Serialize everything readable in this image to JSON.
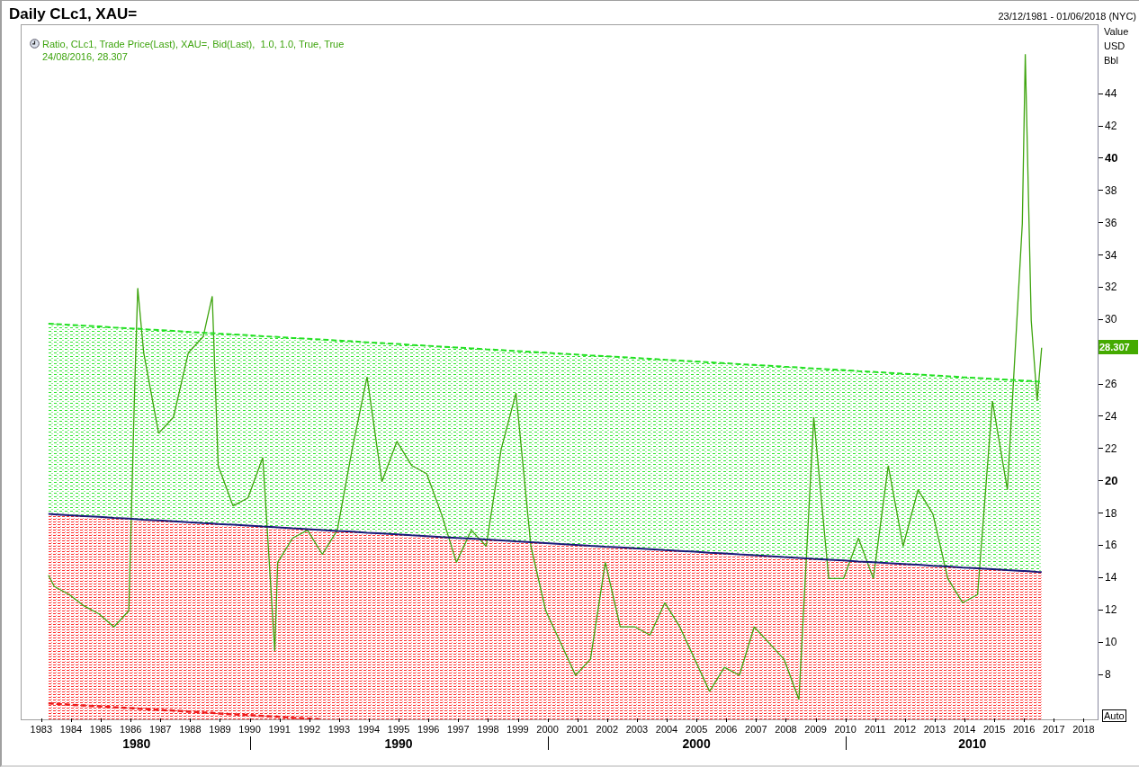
{
  "chart_title": "Daily CLc1, XAU=",
  "date_range": "23/12/1981 - 01/06/2018 (NYC)",
  "legend": {
    "series_text": "Ratio, CLc1, Trade Price(Last), XAU=, Bid(Last),  1.0, 1.0, True, True",
    "last_point": "24/08/2016, 28.307"
  },
  "value_axis": {
    "headings": [
      "Value",
      "USD",
      "Bbl"
    ],
    "last_price": "28.307",
    "auto_button": "Auto"
  },
  "chart_data": {
    "type": "line",
    "xlim": [
      1982.4,
      2018.53
    ],
    "ylim": [
      5.27,
      48.3
    ],
    "xticks": [
      1983,
      1984,
      1985,
      1986,
      1987,
      1988,
      1989,
      1990,
      1991,
      1992,
      1993,
      1994,
      1995,
      1996,
      1997,
      1998,
      1999,
      2000,
      2001,
      2002,
      2003,
      2004,
      2005,
      2006,
      2007,
      2008,
      2009,
      2010,
      2011,
      2012,
      2013,
      2014,
      2015,
      2016,
      2017,
      2018
    ],
    "yticks": [
      8,
      10,
      12,
      14,
      16,
      18,
      20,
      22,
      24,
      26,
      30,
      32,
      34,
      36,
      38,
      40,
      42,
      44
    ],
    "x": [
      1983.3,
      1983.5,
      1984,
      1984.5,
      1985,
      1985.5,
      1986,
      1986.2,
      1986.3,
      1986.5,
      1987,
      1987.5,
      1988,
      1988.5,
      1988.8,
      1989,
      1989.5,
      1990,
      1990.5,
      1990.9,
      1991,
      1991.5,
      1992,
      1992.5,
      1993,
      1993.5,
      1994,
      1994.5,
      1995,
      1995.5,
      1996,
      1996.5,
      1997,
      1997.5,
      1998,
      1998.5,
      1999,
      1999.5,
      2000,
      2000.5,
      2001,
      2001.5,
      2002,
      2002.5,
      2003,
      2003.5,
      2004,
      2004.5,
      2005,
      2005.5,
      2006,
      2006.5,
      2007,
      2007.5,
      2008,
      2008.5,
      2009,
      2009.5,
      2010,
      2010.5,
      2011,
      2011.5,
      2012,
      2012.5,
      2013,
      2013.5,
      2014,
      2014.5,
      2015,
      2015.5,
      2016,
      2016.1,
      2016.3,
      2016.5,
      2016.65
    ],
    "series": [
      {
        "color": "#3ea40e",
        "line_style": "solid",
        "values": [
          14.2,
          13.5,
          13.0,
          12.3,
          11.8,
          11.0,
          12.0,
          26.0,
          32.0,
          28.0,
          23.0,
          24.0,
          28.0,
          29.0,
          31.5,
          21.0,
          18.5,
          19.0,
          21.5,
          9.5,
          15.0,
          16.5,
          17.0,
          15.5,
          17.0,
          22.0,
          26.5,
          20.0,
          22.5,
          21.0,
          20.5,
          18.0,
          15.0,
          17.0,
          16.0,
          22.0,
          25.5,
          16.0,
          12.0,
          10.0,
          8.0,
          9.0,
          15.0,
          11.0,
          11.0,
          10.5,
          12.5,
          11.0,
          9.0,
          7.0,
          8.5,
          8.0,
          11.0,
          10.0,
          9.0,
          6.5,
          24.0,
          14.0,
          14.0,
          16.5,
          14.0,
          21.0,
          16.0,
          19.5,
          18.0,
          14.0,
          12.5,
          13.0,
          25.0,
          19.5,
          36.0,
          46.5,
          30.0,
          25.0,
          28.3
        ]
      },
      {
        "color": "#22e022",
        "line_style": "dashed",
        "values": [
          29.8,
          29.78,
          29.72,
          29.67,
          29.62,
          29.56,
          29.51,
          29.49,
          29.48,
          29.45,
          29.4,
          29.35,
          29.29,
          29.24,
          29.21,
          29.18,
          29.13,
          29.08,
          29.02,
          28.98,
          28.97,
          28.91,
          28.86,
          28.81,
          28.75,
          28.7,
          28.64,
          28.59,
          28.54,
          28.48,
          28.43,
          28.37,
          28.32,
          28.27,
          28.21,
          28.16,
          28.1,
          28.05,
          28.0,
          27.94,
          27.89,
          27.83,
          27.78,
          27.73,
          27.67,
          27.62,
          27.56,
          27.51,
          27.46,
          27.4,
          27.35,
          27.29,
          27.24,
          27.19,
          27.13,
          27.08,
          27.02,
          26.97,
          26.92,
          26.86,
          26.81,
          26.75,
          26.7,
          26.65,
          26.59,
          26.54,
          26.48,
          26.43,
          26.38,
          26.32,
          26.27,
          26.26,
          26.24,
          26.21,
          26.2
        ]
      },
      {
        "color": "#1a1a7a",
        "line_style": "solid",
        "values": [
          18.0,
          17.98,
          17.92,
          17.87,
          17.82,
          17.76,
          17.71,
          17.69,
          17.68,
          17.65,
          17.6,
          17.55,
          17.49,
          17.44,
          17.41,
          17.38,
          17.33,
          17.28,
          17.22,
          17.18,
          17.17,
          17.11,
          17.06,
          17.01,
          16.95,
          16.9,
          16.84,
          16.79,
          16.74,
          16.68,
          16.63,
          16.57,
          16.52,
          16.47,
          16.41,
          16.36,
          16.3,
          16.25,
          16.2,
          16.14,
          16.09,
          16.03,
          15.98,
          15.93,
          15.87,
          15.82,
          15.76,
          15.71,
          15.66,
          15.6,
          15.55,
          15.49,
          15.44,
          15.39,
          15.33,
          15.28,
          15.22,
          15.17,
          15.12,
          15.06,
          15.01,
          14.95,
          14.9,
          14.85,
          14.79,
          14.74,
          14.68,
          14.63,
          14.58,
          14.52,
          14.47,
          14.46,
          14.44,
          14.41,
          14.4
        ]
      },
      {
        "color": "#ee1c1c",
        "line_style": "dashed",
        "values": [
          6.26,
          6.24,
          6.18,
          6.13,
          6.08,
          6.02,
          5.97,
          5.95,
          5.94,
          5.91,
          5.86,
          5.81,
          5.75,
          5.7,
          5.67,
          5.64,
          5.59,
          5.54,
          5.48,
          5.44,
          5.43,
          5.37,
          5.32,
          5.27,
          null,
          null,
          null,
          null,
          null,
          null,
          null,
          null,
          null,
          null,
          null,
          null,
          null,
          null,
          null,
          null,
          null,
          null,
          null,
          null,
          null,
          null,
          null,
          null,
          null,
          null,
          null,
          null,
          null,
          null,
          null,
          null,
          null,
          null,
          null,
          null,
          null,
          null,
          null,
          null,
          null,
          null,
          null,
          null,
          null,
          null,
          null,
          null,
          null,
          null,
          null
        ]
      }
    ]
  },
  "time_axis": {
    "decades": [
      {
        "label": "1980"
      },
      {
        "label": "1990"
      },
      {
        "label": "2000"
      },
      {
        "label": "2010"
      }
    ]
  }
}
